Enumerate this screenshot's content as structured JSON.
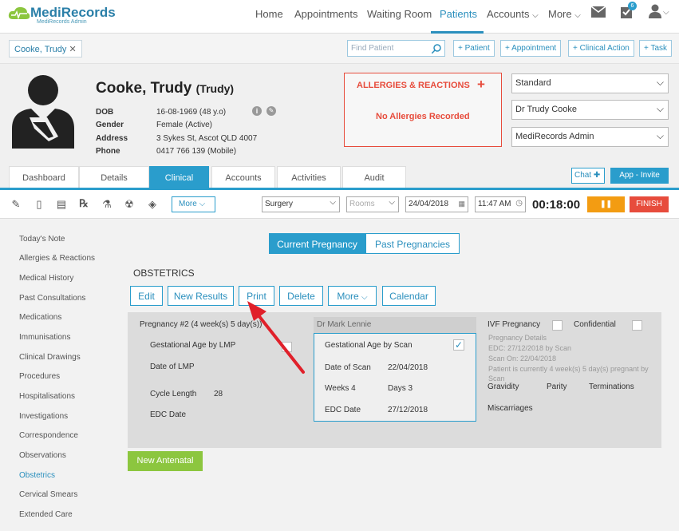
{
  "app": {
    "logo": "MediRecords",
    "logo_sub": "MediRecords Admin"
  },
  "nav": {
    "items": [
      "Home",
      "Appointments",
      "Waiting Room",
      "Patients",
      "Accounts",
      "More"
    ],
    "active": "Patients",
    "task_badge": "6"
  },
  "bar2": {
    "patient_tab": "Cooke, Trudy",
    "find_placeholder": "Find Patient",
    "buttons": [
      "+ Patient",
      "+ Appointment",
      "+ Clinical Action",
      "+ Task"
    ]
  },
  "patient": {
    "name": "Cooke, Trudy",
    "nickname": "(Trudy)",
    "labels": [
      "DOB",
      "Gender",
      "Address",
      "Phone"
    ],
    "values": [
      "16-08-1969 (48 y.o)",
      "Female (Active)",
      "3 Sykes St, Ascot QLD 4007",
      "0417 766 139 (Mobile)"
    ]
  },
  "allergies": {
    "title": "ALLERGIES & REACTIONS",
    "plus": "+",
    "empty": "No Allergies Recorded"
  },
  "selects": [
    "Standard",
    "Dr Trudy Cooke",
    "MediRecords Admin"
  ],
  "tabs": [
    "Dashboard",
    "Details",
    "Clinical",
    "Accounts",
    "Activities",
    "Audit"
  ],
  "active_tab": "Clinical",
  "right_buttons": {
    "chat": "Chat",
    "invite": "App - Invite"
  },
  "toolbar": {
    "more": "More",
    "location": "Surgery",
    "rooms": "Rooms",
    "date": "24/04/2018",
    "time": "11:47 AM",
    "timer": "00:18:00",
    "pause": "❚❚",
    "finish": "FINISH"
  },
  "sidebar": [
    "Today's Note",
    "Allergies & Reactions",
    "Medical History",
    "Past Consultations",
    "Medications",
    "Immunisations",
    "Clinical Drawings",
    "Procedures",
    "Hospitalisations",
    "Investigations",
    "Correspondence",
    "Observations",
    "Obstetrics",
    "Cervical Smears",
    "Extended Care"
  ],
  "sidebar_active": "Obstetrics",
  "obstetrics": {
    "seg_current": "Current Pregnancy",
    "seg_past": "Past Pregnancies",
    "heading": "OBSTETRICS",
    "actions": [
      "Edit",
      "New Results",
      "Print",
      "Delete",
      "More",
      "Calendar"
    ],
    "pregnancy_title": "Pregnancy #2 (4 week(s) 5 day(s))",
    "left": {
      "ga_lmp": "Gestational Age by LMP",
      "date_lmp": "Date of LMP",
      "cycle_label": "Cycle Length",
      "cycle_value": "28",
      "edc": "EDC Date"
    },
    "doctor": "Dr Mark Lennie",
    "scan": {
      "ga_scan": "Gestational Age by Scan",
      "date_scan_label": "Date of Scan",
      "date_scan_value": "22/04/2018",
      "weeks": "Weeks 4",
      "days": "Days 3",
      "edc_label": "EDC Date",
      "edc_value": "27/12/2018"
    },
    "right": {
      "ivf": "IVF Pregnancy",
      "confidential": "Confidential",
      "details": [
        "Pregnancy Details",
        "EDC: 27/12/2018 by Scan",
        "Scan On: 22/04/2018",
        "Patient is currently 4 week(s) 5 day(s) pregnant by",
        "Scan"
      ],
      "gravidity": "Gravidity",
      "parity": "Parity",
      "terminations": "Terminations",
      "miscarriages": "Miscarriages"
    },
    "new_antenatal": "New Antenatal"
  },
  "colors": {
    "accent": "#2a9dcc",
    "alert": "#e74c3c",
    "pause": "#f39c12",
    "finish": "#e74c3c",
    "green": "#8cc63f"
  }
}
